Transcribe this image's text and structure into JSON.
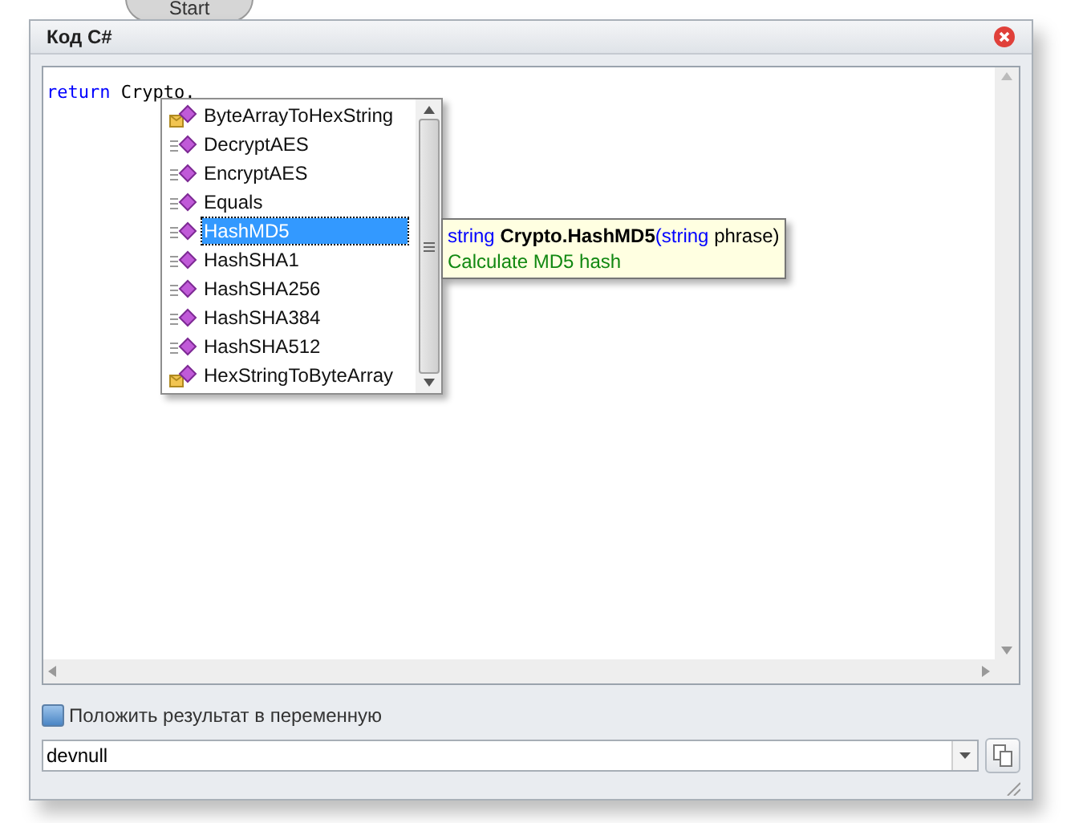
{
  "background_node": {
    "label": "Start"
  },
  "window": {
    "title": "Код C#"
  },
  "editor": {
    "code": [
      {
        "kind": "keyword",
        "text": "return"
      },
      {
        "kind": "plain",
        "text": " Crypto."
      }
    ]
  },
  "completion": {
    "items": [
      {
        "label": "ByteArrayToHexString",
        "kind": "extension",
        "selected": false
      },
      {
        "label": "DecryptAES",
        "kind": "method",
        "selected": false
      },
      {
        "label": "EncryptAES",
        "kind": "method",
        "selected": false
      },
      {
        "label": "Equals",
        "kind": "method",
        "selected": false
      },
      {
        "label": "HashMD5",
        "kind": "method",
        "selected": true
      },
      {
        "label": "HashSHA1",
        "kind": "method",
        "selected": false
      },
      {
        "label": "HashSHA256",
        "kind": "method",
        "selected": false
      },
      {
        "label": "HashSHA384",
        "kind": "method",
        "selected": false
      },
      {
        "label": "HashSHA512",
        "kind": "method",
        "selected": false
      },
      {
        "label": "HexStringToByteArray",
        "kind": "extension",
        "selected": false
      }
    ]
  },
  "tooltip": {
    "signature": [
      {
        "kind": "keyword",
        "text": "string "
      },
      {
        "kind": "name",
        "text": "Crypto.HashMD5"
      },
      {
        "kind": "keyword",
        "text": "(string "
      },
      {
        "kind": "plain",
        "text": "phrase)"
      }
    ],
    "description": "Calculate MD5 hash"
  },
  "result_option": {
    "label": "Положить результат в переменную",
    "checked": false
  },
  "variable_combo": {
    "value": "devnull"
  }
}
